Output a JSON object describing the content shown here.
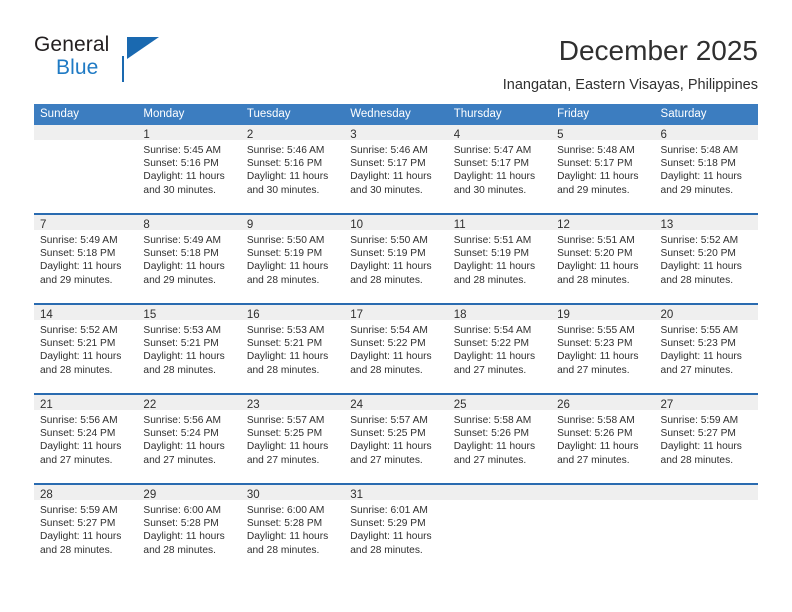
{
  "brand": {
    "name_part1": "General",
    "name_part2": "Blue",
    "logo_icon": "triangle-flag-icon"
  },
  "header": {
    "title": "December 2025",
    "location": "Inangatan, Eastern Visayas, Philippines"
  },
  "calendar": {
    "weekday_headers": [
      "Sunday",
      "Monday",
      "Tuesday",
      "Wednesday",
      "Thursday",
      "Friday",
      "Saturday"
    ],
    "colors": {
      "header_blue": "#3c7dc0",
      "separator_blue": "#2a6bb0",
      "daynum_band": "#efefef",
      "text": "#2f2f2f",
      "brand_blue": "#1f7ac4"
    },
    "weeks": [
      [
        {
          "day": "",
          "sunrise": "",
          "sunset": "",
          "daylight_l1": "",
          "daylight_l2": ""
        },
        {
          "day": "1",
          "sunrise": "Sunrise: 5:45 AM",
          "sunset": "Sunset: 5:16 PM",
          "daylight_l1": "Daylight: 11 hours",
          "daylight_l2": "and 30 minutes."
        },
        {
          "day": "2",
          "sunrise": "Sunrise: 5:46 AM",
          "sunset": "Sunset: 5:16 PM",
          "daylight_l1": "Daylight: 11 hours",
          "daylight_l2": "and 30 minutes."
        },
        {
          "day": "3",
          "sunrise": "Sunrise: 5:46 AM",
          "sunset": "Sunset: 5:17 PM",
          "daylight_l1": "Daylight: 11 hours",
          "daylight_l2": "and 30 minutes."
        },
        {
          "day": "4",
          "sunrise": "Sunrise: 5:47 AM",
          "sunset": "Sunset: 5:17 PM",
          "daylight_l1": "Daylight: 11 hours",
          "daylight_l2": "and 30 minutes."
        },
        {
          "day": "5",
          "sunrise": "Sunrise: 5:48 AM",
          "sunset": "Sunset: 5:17 PM",
          "daylight_l1": "Daylight: 11 hours",
          "daylight_l2": "and 29 minutes."
        },
        {
          "day": "6",
          "sunrise": "Sunrise: 5:48 AM",
          "sunset": "Sunset: 5:18 PM",
          "daylight_l1": "Daylight: 11 hours",
          "daylight_l2": "and 29 minutes."
        }
      ],
      [
        {
          "day": "7",
          "sunrise": "Sunrise: 5:49 AM",
          "sunset": "Sunset: 5:18 PM",
          "daylight_l1": "Daylight: 11 hours",
          "daylight_l2": "and 29 minutes."
        },
        {
          "day": "8",
          "sunrise": "Sunrise: 5:49 AM",
          "sunset": "Sunset: 5:18 PM",
          "daylight_l1": "Daylight: 11 hours",
          "daylight_l2": "and 29 minutes."
        },
        {
          "day": "9",
          "sunrise": "Sunrise: 5:50 AM",
          "sunset": "Sunset: 5:19 PM",
          "daylight_l1": "Daylight: 11 hours",
          "daylight_l2": "and 28 minutes."
        },
        {
          "day": "10",
          "sunrise": "Sunrise: 5:50 AM",
          "sunset": "Sunset: 5:19 PM",
          "daylight_l1": "Daylight: 11 hours",
          "daylight_l2": "and 28 minutes."
        },
        {
          "day": "11",
          "sunrise": "Sunrise: 5:51 AM",
          "sunset": "Sunset: 5:19 PM",
          "daylight_l1": "Daylight: 11 hours",
          "daylight_l2": "and 28 minutes."
        },
        {
          "day": "12",
          "sunrise": "Sunrise: 5:51 AM",
          "sunset": "Sunset: 5:20 PM",
          "daylight_l1": "Daylight: 11 hours",
          "daylight_l2": "and 28 minutes."
        },
        {
          "day": "13",
          "sunrise": "Sunrise: 5:52 AM",
          "sunset": "Sunset: 5:20 PM",
          "daylight_l1": "Daylight: 11 hours",
          "daylight_l2": "and 28 minutes."
        }
      ],
      [
        {
          "day": "14",
          "sunrise": "Sunrise: 5:52 AM",
          "sunset": "Sunset: 5:21 PM",
          "daylight_l1": "Daylight: 11 hours",
          "daylight_l2": "and 28 minutes."
        },
        {
          "day": "15",
          "sunrise": "Sunrise: 5:53 AM",
          "sunset": "Sunset: 5:21 PM",
          "daylight_l1": "Daylight: 11 hours",
          "daylight_l2": "and 28 minutes."
        },
        {
          "day": "16",
          "sunrise": "Sunrise: 5:53 AM",
          "sunset": "Sunset: 5:21 PM",
          "daylight_l1": "Daylight: 11 hours",
          "daylight_l2": "and 28 minutes."
        },
        {
          "day": "17",
          "sunrise": "Sunrise: 5:54 AM",
          "sunset": "Sunset: 5:22 PM",
          "daylight_l1": "Daylight: 11 hours",
          "daylight_l2": "and 28 minutes."
        },
        {
          "day": "18",
          "sunrise": "Sunrise: 5:54 AM",
          "sunset": "Sunset: 5:22 PM",
          "daylight_l1": "Daylight: 11 hours",
          "daylight_l2": "and 27 minutes."
        },
        {
          "day": "19",
          "sunrise": "Sunrise: 5:55 AM",
          "sunset": "Sunset: 5:23 PM",
          "daylight_l1": "Daylight: 11 hours",
          "daylight_l2": "and 27 minutes."
        },
        {
          "day": "20",
          "sunrise": "Sunrise: 5:55 AM",
          "sunset": "Sunset: 5:23 PM",
          "daylight_l1": "Daylight: 11 hours",
          "daylight_l2": "and 27 minutes."
        }
      ],
      [
        {
          "day": "21",
          "sunrise": "Sunrise: 5:56 AM",
          "sunset": "Sunset: 5:24 PM",
          "daylight_l1": "Daylight: 11 hours",
          "daylight_l2": "and 27 minutes."
        },
        {
          "day": "22",
          "sunrise": "Sunrise: 5:56 AM",
          "sunset": "Sunset: 5:24 PM",
          "daylight_l1": "Daylight: 11 hours",
          "daylight_l2": "and 27 minutes."
        },
        {
          "day": "23",
          "sunrise": "Sunrise: 5:57 AM",
          "sunset": "Sunset: 5:25 PM",
          "daylight_l1": "Daylight: 11 hours",
          "daylight_l2": "and 27 minutes."
        },
        {
          "day": "24",
          "sunrise": "Sunrise: 5:57 AM",
          "sunset": "Sunset: 5:25 PM",
          "daylight_l1": "Daylight: 11 hours",
          "daylight_l2": "and 27 minutes."
        },
        {
          "day": "25",
          "sunrise": "Sunrise: 5:58 AM",
          "sunset": "Sunset: 5:26 PM",
          "daylight_l1": "Daylight: 11 hours",
          "daylight_l2": "and 27 minutes."
        },
        {
          "day": "26",
          "sunrise": "Sunrise: 5:58 AM",
          "sunset": "Sunset: 5:26 PM",
          "daylight_l1": "Daylight: 11 hours",
          "daylight_l2": "and 27 minutes."
        },
        {
          "day": "27",
          "sunrise": "Sunrise: 5:59 AM",
          "sunset": "Sunset: 5:27 PM",
          "daylight_l1": "Daylight: 11 hours",
          "daylight_l2": "and 28 minutes."
        }
      ],
      [
        {
          "day": "28",
          "sunrise": "Sunrise: 5:59 AM",
          "sunset": "Sunset: 5:27 PM",
          "daylight_l1": "Daylight: 11 hours",
          "daylight_l2": "and 28 minutes."
        },
        {
          "day": "29",
          "sunrise": "Sunrise: 6:00 AM",
          "sunset": "Sunset: 5:28 PM",
          "daylight_l1": "Daylight: 11 hours",
          "daylight_l2": "and 28 minutes."
        },
        {
          "day": "30",
          "sunrise": "Sunrise: 6:00 AM",
          "sunset": "Sunset: 5:28 PM",
          "daylight_l1": "Daylight: 11 hours",
          "daylight_l2": "and 28 minutes."
        },
        {
          "day": "31",
          "sunrise": "Sunrise: 6:01 AM",
          "sunset": "Sunset: 5:29 PM",
          "daylight_l1": "Daylight: 11 hours",
          "daylight_l2": "and 28 minutes."
        },
        {
          "day": "",
          "sunrise": "",
          "sunset": "",
          "daylight_l1": "",
          "daylight_l2": ""
        },
        {
          "day": "",
          "sunrise": "",
          "sunset": "",
          "daylight_l1": "",
          "daylight_l2": ""
        },
        {
          "day": "",
          "sunrise": "",
          "sunset": "",
          "daylight_l1": "",
          "daylight_l2": ""
        }
      ]
    ]
  }
}
